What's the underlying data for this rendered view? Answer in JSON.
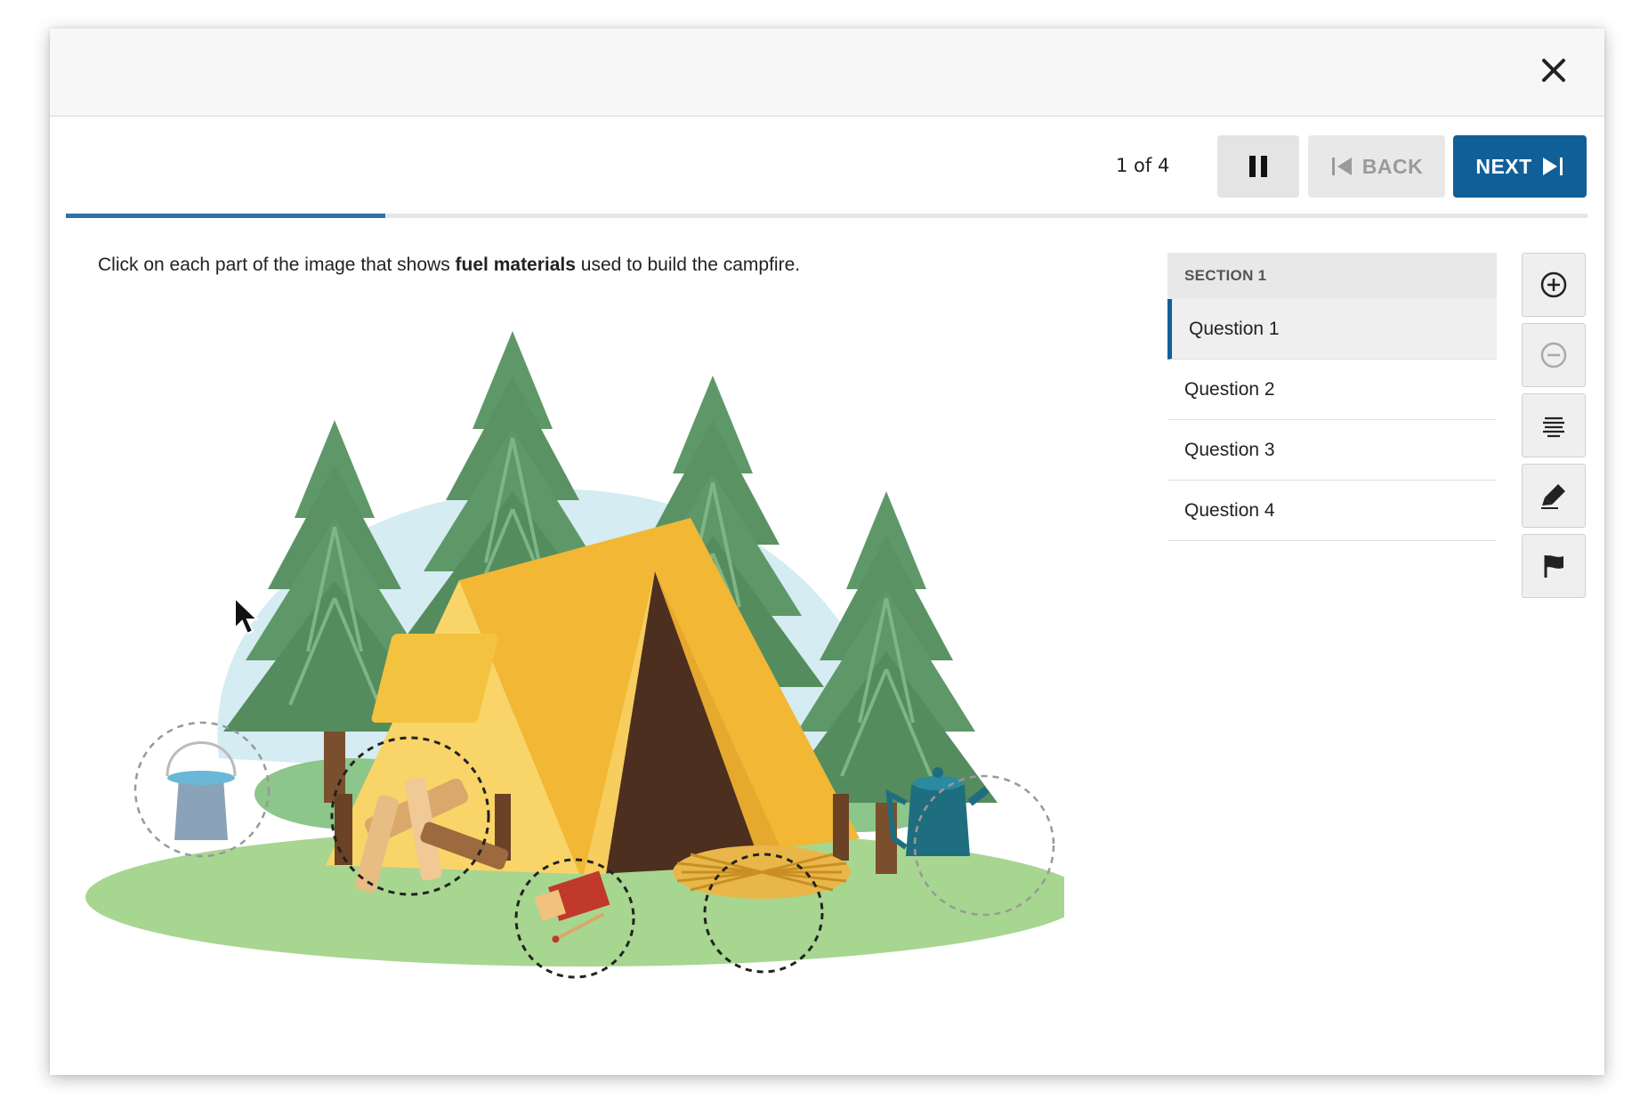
{
  "header": {
    "close_icon": "close-icon"
  },
  "nav": {
    "counter": "1 of 4",
    "back_label": "BACK",
    "next_label": "NEXT",
    "progress_fraction": 0.21
  },
  "question": {
    "prompt_before": "Click on each part of the image that shows ",
    "prompt_bold": "fuel materials",
    "prompt_after": " used to build the campfire."
  },
  "sidebar": {
    "section_title": "SECTION 1",
    "items": [
      {
        "label": "Question 1",
        "active": true
      },
      {
        "label": "Question 2",
        "active": false
      },
      {
        "label": "Question 3",
        "active": false
      },
      {
        "label": "Question 4",
        "active": false
      }
    ]
  },
  "tools": [
    "zoom-in-icon",
    "zoom-out-icon",
    "line-reader-icon",
    "highlighter-icon",
    "flag-icon"
  ],
  "colors": {
    "accent": "#115f98",
    "progress": "#2e72a8",
    "tent": "#f5c242",
    "trees": "#5f9868",
    "grass": "#a7d690"
  }
}
